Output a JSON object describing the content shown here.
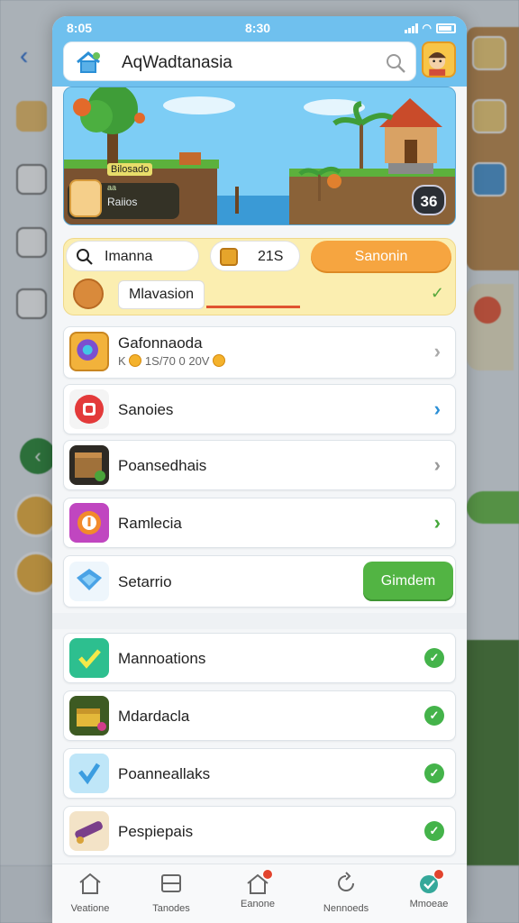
{
  "status_bar": {
    "left": "8:05",
    "center": "8:30"
  },
  "header": {
    "title": "AqWadtanasia",
    "search_placeholder": ""
  },
  "banner": {
    "card_title": "Bilosado",
    "card_subtitle": "aa",
    "card_name": "Raiios",
    "count_badge": "36"
  },
  "quick_panel": {
    "search_value": "Imanna",
    "coins": "21S",
    "action_button": "Sanonin",
    "mission_label": "Mlavasion"
  },
  "list": [
    {
      "label": "Gafonnaoda",
      "subtitle_a": "K",
      "subtitle_b": "1S/70 0 20V",
      "control": "chevron",
      "icon_color": "#7b4fd0"
    },
    {
      "label": "Sanoies",
      "control": "chevron-blue",
      "icon_color": "#e33a3a"
    },
    {
      "label": "Poansedhais",
      "control": "chevron",
      "icon_color": "#7a5a2e"
    },
    {
      "label": "Ramlecia",
      "control": "chevron-green",
      "icon_color": "#c046c0"
    },
    {
      "label": "Setarrio",
      "control": "button",
      "button_label": "Gimdem",
      "icon_color": "#4aa3e6"
    }
  ],
  "tasks": [
    {
      "label": "Mannoations",
      "icon_color": "#2dbf8f"
    },
    {
      "label": "Mdardacla",
      "icon_color": "#5b7a2c"
    },
    {
      "label": "Poanneallaks",
      "icon_color": "#8ed1ef"
    },
    {
      "label": "Pespiepais",
      "icon_color": "#7a3f8a"
    }
  ],
  "bottom_nav": [
    {
      "label": "Veatione",
      "icon": "home-icon"
    },
    {
      "label": "Tanodes",
      "icon": "inbox-icon"
    },
    {
      "label": "Eanone",
      "icon": "house-badge-icon"
    },
    {
      "label": "Nennoeds",
      "icon": "refresh-icon"
    },
    {
      "label": "Mmoeae",
      "icon": "sync-badge-icon"
    }
  ],
  "colors": {
    "primary": "#6fc0ee",
    "orange": "#f6a540",
    "green": "#52b443",
    "highlight": "#fbeeb0"
  }
}
